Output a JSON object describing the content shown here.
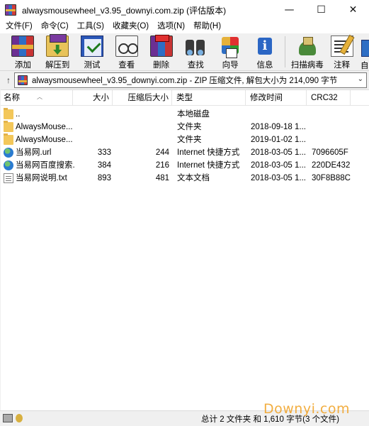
{
  "window": {
    "title": "alwaysmousewheel_v3.95_downyi.com.zip (评估版本)",
    "controls": {
      "minimize": "—",
      "maximize": "☐",
      "close": "✕"
    }
  },
  "menu": [
    "文件(F)",
    "命令(C)",
    "工具(S)",
    "收藏夹(O)",
    "选项(N)",
    "帮助(H)"
  ],
  "toolbar": [
    {
      "label": "添加",
      "icon": "add-icon"
    },
    {
      "label": "解压到",
      "icon": "extract-icon"
    },
    {
      "label": "测试",
      "icon": "test-icon"
    },
    {
      "label": "查看",
      "icon": "view-icon"
    },
    {
      "label": "删除",
      "icon": "delete-icon"
    },
    {
      "label": "查找",
      "icon": "find-icon"
    },
    {
      "label": "向导",
      "icon": "wizard-icon"
    },
    {
      "label": "信息",
      "icon": "info-icon"
    },
    {
      "label": "扫描病毒",
      "icon": "scan-icon"
    },
    {
      "label": "注释",
      "icon": "comment-icon"
    },
    {
      "label": "自",
      "icon": "sfx-icon"
    }
  ],
  "address": {
    "up_arrow": "↑",
    "path": "alwaysmousewheel_v3.95_downyi.com.zip - ZIP 压缩文件, 解包大小为 214,090 字节",
    "dropdown": "⌄"
  },
  "columns": {
    "name": "名称",
    "size": "大小",
    "packed": "压缩后大小",
    "type": "类型",
    "modified": "修改时间",
    "crc": "CRC32"
  },
  "files": [
    {
      "name": "..",
      "icon": "folder-icon",
      "size": "",
      "packed": "",
      "type": "本地磁盘",
      "modified": "",
      "crc": ""
    },
    {
      "name": "AlwaysMouse...",
      "icon": "folder-icon",
      "size": "",
      "packed": "",
      "type": "文件夹",
      "modified": "2018-09-18 1...",
      "crc": ""
    },
    {
      "name": "AlwaysMouse...",
      "icon": "folder-icon",
      "size": "",
      "packed": "",
      "type": "文件夹",
      "modified": "2019-01-02 1...",
      "crc": ""
    },
    {
      "name": "当易网.url",
      "icon": "globe-icon",
      "size": "333",
      "packed": "244",
      "type": "Internet 快捷方式",
      "modified": "2018-03-05 1...",
      "crc": "7096605F"
    },
    {
      "name": "当易网百度搜索...",
      "icon": "globe-icon",
      "size": "384",
      "packed": "216",
      "type": "Internet 快捷方式",
      "modified": "2018-03-05 1...",
      "crc": "220DE432"
    },
    {
      "name": "当易网说明.txt",
      "icon": "txt-icon",
      "size": "893",
      "packed": "481",
      "type": "文本文档",
      "modified": "2018-03-05 1...",
      "crc": "30F8B88C"
    }
  ],
  "status": {
    "text": "总计 2 文件夹 和 1,610 字节(3 个文件)"
  },
  "watermark": "Downyi.com"
}
